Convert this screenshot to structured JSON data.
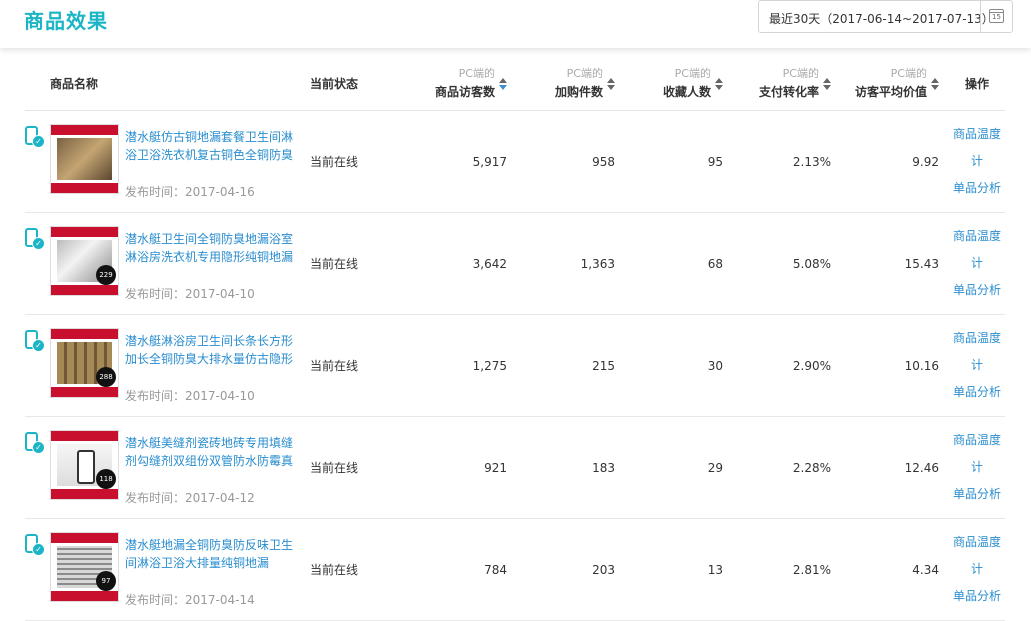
{
  "header": {
    "title": "商品效果",
    "date_range": "最近30天（2017-06-14~2017-07-13）",
    "calendar_num": "15"
  },
  "columns": {
    "name": "商品名称",
    "status": "当前状态",
    "visitors": {
      "sub": "PC端的",
      "main": "商品访客数"
    },
    "cart": {
      "sub": "PC端的",
      "main": "加购件数"
    },
    "favorites": {
      "sub": "PC端的",
      "main": "收藏人数"
    },
    "conversion": {
      "sub": "PC端的",
      "main": "支付转化率"
    },
    "avg_value": {
      "sub": "PC端的",
      "main": "访客平均价值"
    },
    "ops": "操作"
  },
  "rows": [
    {
      "title": "潜水艇仿古铜地漏套餐卫生间淋浴卫浴洗衣机复古铜色全铜防臭",
      "date": "发布时间：2017-04-16",
      "status": "当前在线",
      "visitors": "5,917",
      "cart": "958",
      "favorites": "95",
      "conversion": "2.13%",
      "avg_value": "9.92",
      "op1": "商品温度计",
      "op2": "单品分析"
    },
    {
      "title": "潜水艇卫生间全铜防臭地漏浴室淋浴房洗衣机专用隐形纯铜地漏",
      "date": "发布时间：2017-04-10",
      "status": "当前在线",
      "visitors": "3,642",
      "cart": "1,363",
      "favorites": "68",
      "conversion": "5.08%",
      "avg_value": "15.43",
      "op1": "商品温度计",
      "op2": "单品分析"
    },
    {
      "title": "潜水艇淋浴房卫生间长条长方形加长全铜防臭大排水量仿古隐形",
      "date": "发布时间：2017-04-10",
      "status": "当前在线",
      "visitors": "1,275",
      "cart": "215",
      "favorites": "30",
      "conversion": "2.90%",
      "avg_value": "10.16",
      "op1": "商品温度计",
      "op2": "单品分析"
    },
    {
      "title": "潜水艇美缝剂瓷砖地砖专用填缝剂勾缝剂双组份双管防水防霉真",
      "date": "发布时间：2017-04-12",
      "status": "当前在线",
      "visitors": "921",
      "cart": "183",
      "favorites": "29",
      "conversion": "2.28%",
      "avg_value": "12.46",
      "op1": "商品温度计",
      "op2": "单品分析"
    },
    {
      "title": "潜水艇地漏全铜防臭防反味卫生间淋浴卫浴大排量纯铜地漏",
      "date": "发布时间：2017-04-14",
      "status": "当前在线",
      "visitors": "784",
      "cart": "203",
      "favorites": "13",
      "conversion": "2.81%",
      "avg_value": "4.34",
      "op1": "商品温度计",
      "op2": "单品分析"
    }
  ],
  "thumbs": [
    {
      "price": ""
    },
    {
      "price": "229"
    },
    {
      "price": "288"
    },
    {
      "price": "118"
    },
    {
      "price": "97"
    }
  ],
  "colors": {
    "accent": "#1bb5c6",
    "link": "#2a8ecf",
    "active_sort": "#3d8fd6"
  }
}
